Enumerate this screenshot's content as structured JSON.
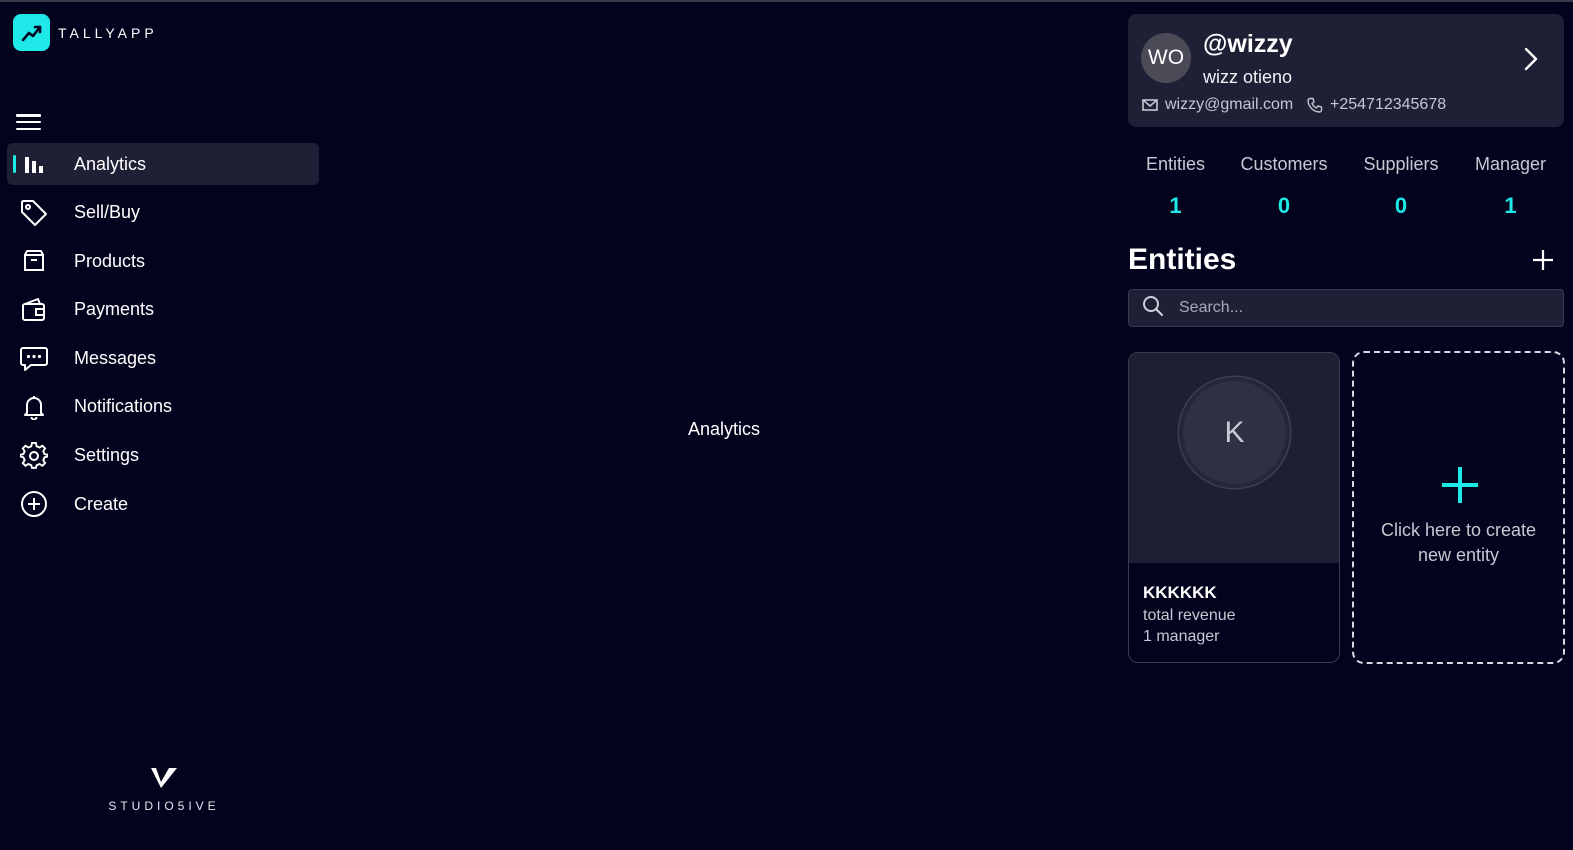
{
  "app": {
    "name": "TALLYAPP",
    "brand_color": "#1ee8e8",
    "background": "#03031d"
  },
  "sidebar": {
    "menu_icon": "hamburger-icon",
    "items": [
      {
        "label": "Analytics",
        "icon": "bar-chart-icon",
        "active": true
      },
      {
        "label": "Sell/Buy",
        "icon": "tag-icon",
        "active": false
      },
      {
        "label": "Products",
        "icon": "box-icon",
        "active": false
      },
      {
        "label": "Payments",
        "icon": "wallet-icon",
        "active": false
      },
      {
        "label": "Messages",
        "icon": "chat-icon",
        "active": false
      },
      {
        "label": "Notifications",
        "icon": "bell-icon",
        "active": false
      },
      {
        "label": "Settings",
        "icon": "gear-icon",
        "active": false
      },
      {
        "label": "Create",
        "icon": "plus-circle-icon",
        "active": false
      }
    ],
    "studio_brand": "STUDIO5IVE"
  },
  "main": {
    "page_label": "Analytics"
  },
  "profile": {
    "initials": "WO",
    "handle": "@wizzy",
    "name": "wizz otieno",
    "email": "wizzy@gmail.com",
    "phone": "+254712345678"
  },
  "stats": [
    {
      "label": "Entities",
      "value": "1"
    },
    {
      "label": "Customers",
      "value": "0"
    },
    {
      "label": "Suppliers",
      "value": "0"
    },
    {
      "label": "Manager",
      "value": "1"
    }
  ],
  "entities": {
    "title": "Entities",
    "search_placeholder": "Search...",
    "items": [
      {
        "initial": "K",
        "name": "KKKKKK",
        "revenue_label": "total revenue",
        "managers_label": "1 manager"
      }
    ],
    "create_label": "Click here to create new entity"
  }
}
